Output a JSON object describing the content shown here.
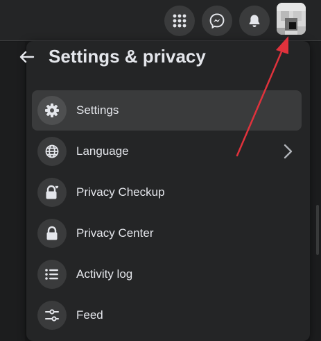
{
  "panel": {
    "title": "Settings & privacy",
    "items": [
      {
        "label": "Settings",
        "icon": "gear-icon",
        "active": true
      },
      {
        "label": "Language",
        "icon": "globe-icon",
        "chevron": true
      },
      {
        "label": "Privacy Checkup",
        "icon": "lock-heart-icon"
      },
      {
        "label": "Privacy Center",
        "icon": "lock-icon"
      },
      {
        "label": "Activity log",
        "icon": "list-icon"
      },
      {
        "label": "Feed",
        "icon": "sliders-icon"
      }
    ]
  },
  "topbar": {
    "buttons": [
      "menu-grid-icon",
      "messenger-icon",
      "notifications-bell-icon",
      "account-avatar"
    ]
  },
  "colors": {
    "panel_bg": "#242526",
    "hover_bg": "#3a3b3c",
    "text": "#e4e6eb",
    "annotation_arrow": "#e0323c"
  }
}
